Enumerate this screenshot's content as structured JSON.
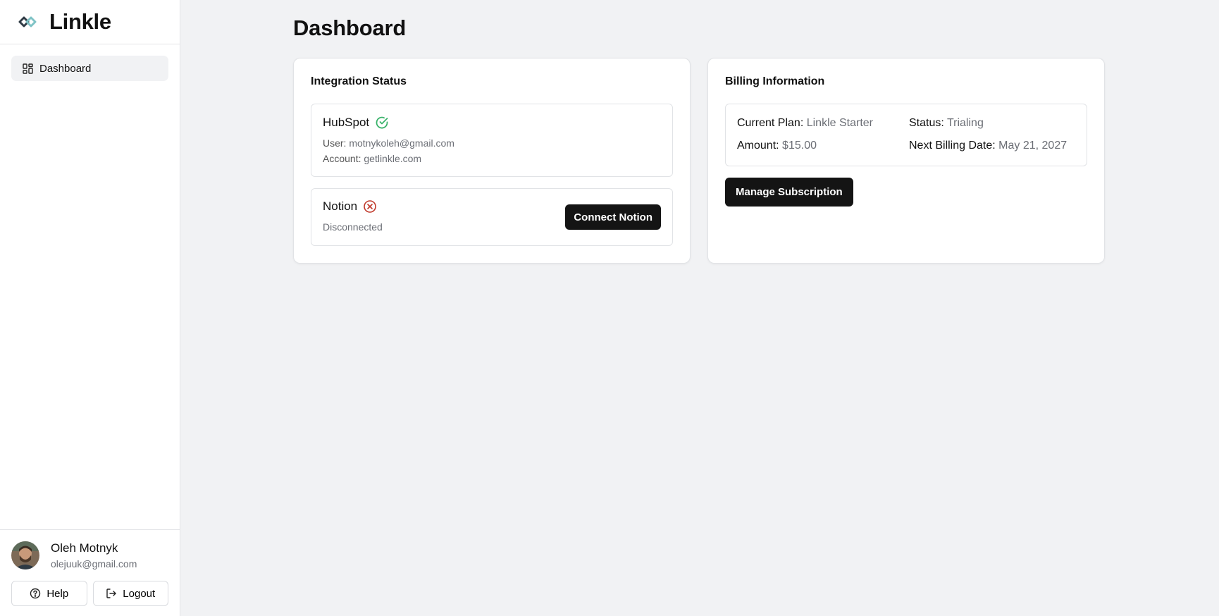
{
  "brand": {
    "name": "Linkle"
  },
  "nav": {
    "items": [
      {
        "label": "Dashboard",
        "icon": "grid-icon"
      }
    ]
  },
  "user": {
    "name": "Oleh Motnyk",
    "email": "olejuuk@gmail.com"
  },
  "actions": {
    "help_label": "Help",
    "logout_label": "Logout"
  },
  "page": {
    "title": "Dashboard"
  },
  "integration": {
    "title": "Integration Status",
    "hubspot": {
      "name": "HubSpot",
      "status": "connected",
      "user_label": "User:",
      "user_value": "motnykoleh@gmail.com",
      "account_label": "Account:",
      "account_value": "getlinkle.com"
    },
    "notion": {
      "name": "Notion",
      "status_text": "Disconnected",
      "connect_label": "Connect Notion"
    }
  },
  "billing": {
    "title": "Billing Information",
    "plan_label": "Current Plan:",
    "plan_value": "Linkle Starter",
    "status_label": "Status:",
    "status_value": "Trialing",
    "amount_label": "Amount:",
    "amount_value": "$15.00",
    "next_label": "Next Billing Date:",
    "next_value": "May 21, 2027",
    "manage_label": "Manage Subscription"
  },
  "colors": {
    "success": "#3bb36b",
    "danger": "#c0392b",
    "dark_button": "#141414"
  }
}
